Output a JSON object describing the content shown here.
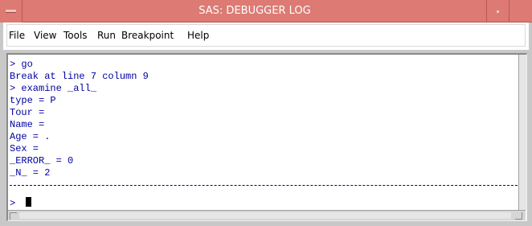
{
  "window": {
    "title": "SAS: DEBUGGER LOG",
    "accent_color": "#dd7a74"
  },
  "menu": {
    "items": [
      "File",
      "View",
      "Tools",
      "Run",
      "Breakpoint",
      "Help"
    ]
  },
  "log": {
    "text_color": "#0000a0",
    "lines": [
      "> go",
      "Break at line 7 column 9",
      "> examine _all_",
      "type = P",
      "Tour =",
      "Name =",
      "Age = .",
      "Sex =",
      "_ERROR_ = 0",
      "_N_ = 2"
    ]
  },
  "command": {
    "prompt": ">",
    "value": ""
  }
}
